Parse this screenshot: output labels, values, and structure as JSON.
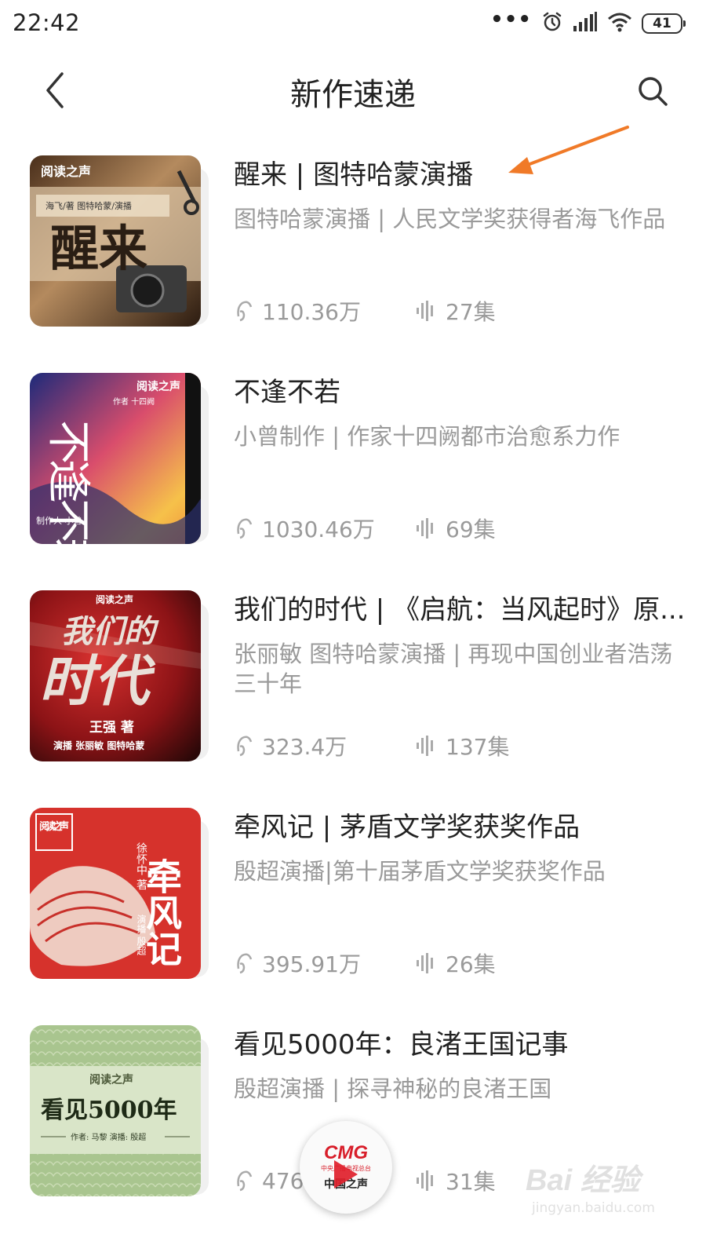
{
  "status_bar": {
    "time": "22:42",
    "battery": "41",
    "icons": [
      "more-dots-icon",
      "alarm-icon",
      "signal-icon",
      "wifi-icon",
      "battery-icon"
    ]
  },
  "header": {
    "title": "新作速递",
    "back_icon": "back-chevron-icon",
    "search_icon": "search-icon"
  },
  "books": [
    {
      "title": "醒来 | 图特哈蒙演播",
      "description": "图特哈蒙演播 | 人民文学奖获得者海飞作品",
      "plays": "110.36万",
      "episodes": "27集",
      "cover": {
        "badge": "阅读之声",
        "credits": "海飞/著  图特哈蒙/演播",
        "big_title": "醒来",
        "colors": [
          "#6b4a2e",
          "#c9a77c",
          "#3a2616"
        ]
      }
    },
    {
      "title": "不逢不若",
      "description": "小曾制作 | 作家十四阙都市治愈系力作",
      "plays": "1030.46万",
      "episodes": "69集",
      "cover": {
        "badge": "阅读之声",
        "credits": "作者 十四阙",
        "big_title": "不逢不若",
        "producer": "制作人 小曾",
        "colors": [
          "#2b3a8f",
          "#e85a6a",
          "#f5c04a"
        ]
      }
    },
    {
      "title": "我们的时代 | 《启航：当风起时》原...",
      "description": "张丽敏 图特哈蒙演播 | 再现中国创业者浩荡三十年",
      "plays": "323.4万",
      "episodes": "137集",
      "cover": {
        "badge": "阅读之声",
        "big_title_top": "我们的",
        "big_title_bottom": "时代",
        "author": "王强 著",
        "credits": "演播 张丽敏 图特哈蒙",
        "colors": [
          "#8f1116",
          "#c8242a",
          "#2a0a0a"
        ]
      }
    },
    {
      "title": "牵风记 | 茅盾文学奖获奖作品",
      "description": "殷超演播|第十届茅盾文学奖获奖作品",
      "plays": "395.91万",
      "episodes": "26集",
      "cover": {
        "badge": "阅读之声",
        "big_title": "牵风记",
        "author": "徐怀中 著",
        "credits": "演播 殷超",
        "colors": [
          "#d8322d",
          "#f1e7dc",
          "#a51d1a"
        ]
      }
    },
    {
      "title": "看见5000年：良渚王国记事",
      "description": "殷超演播 | 探寻神秘的良渚王国",
      "plays": "476",
      "episodes": "31集",
      "cover": {
        "badge": "阅读之声",
        "big_title": "看见5000年",
        "credits": "作者: 马黎   演播: 殷超",
        "colors": [
          "#a9c58f",
          "#c9dbb3",
          "#2e3b22"
        ]
      }
    }
  ],
  "mini_player": {
    "logo": "CMG",
    "sub": "中央广播电视总台",
    "label": "中国之声"
  },
  "watermark": {
    "main": "Bai 经验",
    "sub": "jingyan.baidu.com"
  }
}
